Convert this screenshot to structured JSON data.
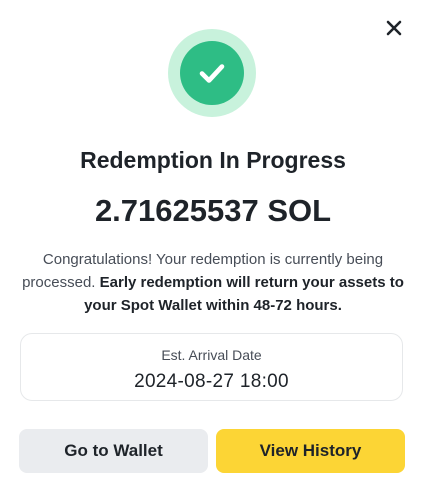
{
  "modal": {
    "title": "Redemption In Progress",
    "amount": "2.71625537 SOL",
    "message_plain": "Congratulations! Your redemption is currently being processed. ",
    "message_bold": "Early redemption will return your assets to your Spot Wallet within 48-72 hours.",
    "arrival": {
      "label": "Est. Arrival Date",
      "value": "2024-08-27 18:00"
    },
    "buttons": {
      "secondary_label": "Go to Wallet",
      "primary_label": "View History"
    },
    "icons": {
      "close": "close-icon",
      "status": "check-circle-icon"
    },
    "colors": {
      "success": "#2ebd85",
      "success_halo": "#c8f2dc",
      "primary_button": "#fcd535",
      "secondary_button": "#eaecef",
      "text": "#1e2329"
    }
  }
}
